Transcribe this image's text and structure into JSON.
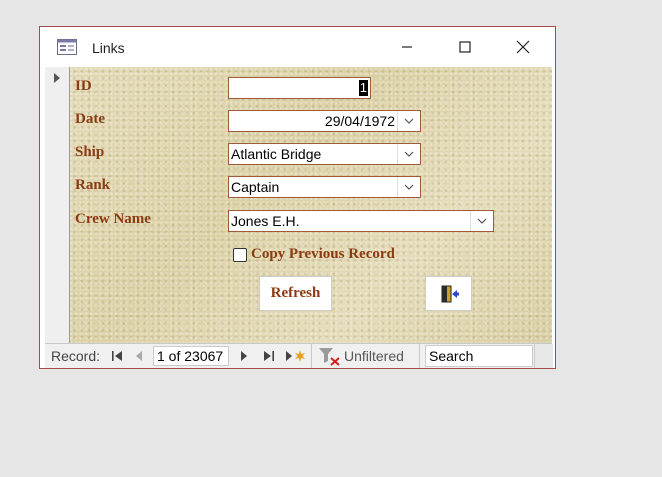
{
  "window": {
    "title": "Links"
  },
  "form": {
    "fields": [
      {
        "label": "ID",
        "value": "1"
      },
      {
        "label": "Date",
        "value": "29/04/1972"
      },
      {
        "label": "Ship",
        "value": "Atlantic Bridge"
      },
      {
        "label": "Rank",
        "value": "Captain"
      },
      {
        "label": "Crew Name",
        "value": "Jones E.H."
      }
    ],
    "copy_previous_label": "Copy Previous Record",
    "copy_previous_checked": false,
    "refresh_label": "Refresh",
    "exit_icon": "exit-door-icon"
  },
  "navigation": {
    "record_label": "Record:",
    "current_record": "1 of 23067",
    "filter_label": "Unfiltered",
    "search_label": "Search"
  },
  "colors": {
    "label_text": "#8b3a12",
    "window_border": "#a84a4a",
    "field_border": "#a05a3a",
    "detail_background": "#dfd6ae"
  }
}
